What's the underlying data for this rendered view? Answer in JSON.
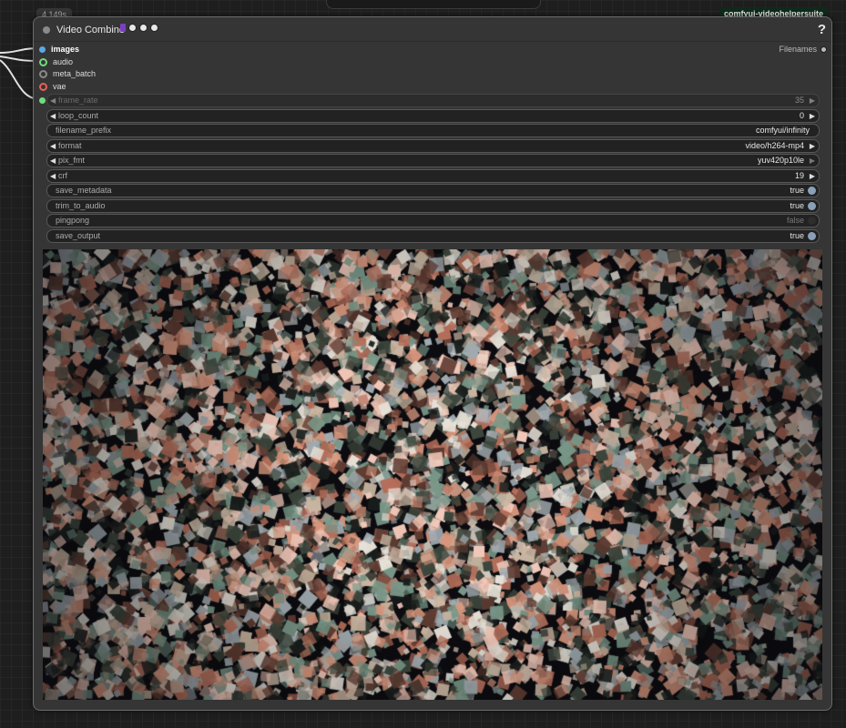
{
  "node": {
    "exec_time": "4.149s",
    "title": "Video Combine",
    "badge": "comfyui-videohelpersuite",
    "help_label": "?",
    "colors": {
      "node_bg": "#353535",
      "badge_bg": "#0f2a1a"
    },
    "title_icons": [
      "film-icon",
      "circle-icon",
      "circle-icon",
      "circle-icon"
    ]
  },
  "inputs": [
    {
      "label": "images",
      "color": "#5aa8e8",
      "connected": true
    },
    {
      "label": "audio",
      "color": "#6fdc7b",
      "connected": true
    },
    {
      "label": "meta_batch",
      "color": "#8a8a8a",
      "connected": false
    },
    {
      "label": "vae",
      "color": "#e8605a",
      "connected": false
    }
  ],
  "output": {
    "label": "Filenames"
  },
  "widgets": {
    "frame_rate": {
      "label": "frame_rate",
      "value": "35"
    },
    "loop_count": {
      "label": "loop_count",
      "value": "0"
    },
    "filename_prefix": {
      "label": "filename_prefix",
      "value": "comfyui/infinity"
    },
    "format": {
      "label": "format",
      "value": "video/h264-mp4"
    },
    "pix_fmt": {
      "label": "pix_fmt",
      "value": "yuv420p10le"
    },
    "crf": {
      "label": "crf",
      "value": "19"
    },
    "save_metadata": {
      "label": "save_metadata",
      "value": "true"
    },
    "trim_to_audio": {
      "label": "trim_to_audio",
      "value": "true"
    },
    "pingpong": {
      "label": "pingpong",
      "value": "false"
    },
    "save_output": {
      "label": "save_output",
      "value": "true"
    }
  }
}
